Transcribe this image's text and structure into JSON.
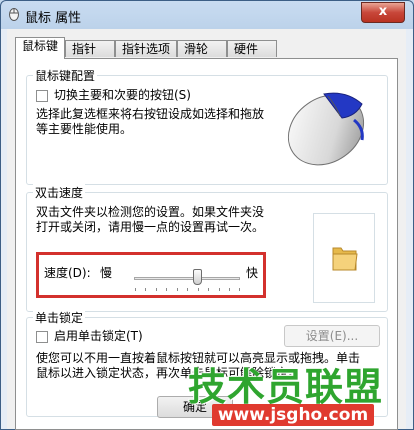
{
  "window": {
    "title": "鼠标 属性",
    "close_glyph": "x"
  },
  "tabs": [
    {
      "label": "鼠标键"
    },
    {
      "label": "指针"
    },
    {
      "label": "指针选项"
    },
    {
      "label": "滑轮"
    },
    {
      "label": "硬件"
    }
  ],
  "button_config": {
    "group_title": "鼠标键配置",
    "checkbox_label": "切换主要和次要的按钮(S)",
    "description_line1": "选择此复选框来将右按钮设成如选择和拖放",
    "description_line2": "等主要性能使用。",
    "checked": false
  },
  "double_click": {
    "group_title": "双击速度",
    "description_line1": "双击文件夹以检测您的设置。如果文件夹没",
    "description_line2": "打开或关闭，请用慢一点的设置再试一次。",
    "speed_label": "速度(D):",
    "slow_label": "慢",
    "fast_label": "快",
    "speed_fraction": 0.6
  },
  "click_lock": {
    "group_title": "单击锁定",
    "checkbox_label": "启用单击锁定(T)",
    "settings_button": "设置(E)...",
    "description_line1": "使您可以不用一直按着鼠标按钮就可以高亮显示或拖拽。单击",
    "description_line2": "鼠标以进入锁定状态，再次单击鼠标可解除锁定。",
    "checked": false
  },
  "footer": {
    "ok_button": "确定"
  },
  "watermark": {
    "brand": "技术员联盟",
    "url": "www.jsgho.com"
  }
}
